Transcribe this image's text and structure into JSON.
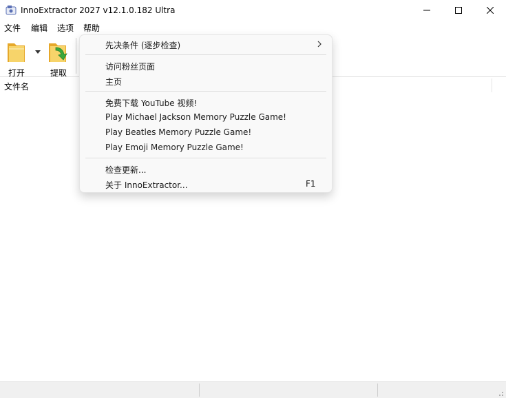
{
  "window": {
    "title": "InnoExtractor 2027 v12.1.0.182 Ultra",
    "controls": [
      "minimize-icon",
      "maximize-icon",
      "close-icon"
    ]
  },
  "menubar": {
    "file": "文件",
    "edit": "编辑",
    "options": "选项",
    "help": "帮助"
  },
  "toolbar": {
    "open_label": "打开",
    "extract_label": "提取"
  },
  "list": {
    "column_filename": "文件名"
  },
  "help_menu": {
    "prerequisites": "先决条件 (逐步检查)",
    "visit_fan_page": "访问粉丝页面",
    "homepage": "主页",
    "youtube": "免费下载 YouTube 视频!",
    "mj_game": "Play Michael Jackson Memory Puzzle Game!",
    "beatles_game": "Play Beatles Memory Puzzle Game!",
    "emoji_game": "Play Emoji Memory Puzzle Game!",
    "check_updates": "检查更新...",
    "about": "关于 InnoExtractor...",
    "about_shortcut": "F1"
  },
  "colors": {
    "folder": "#f2c24a",
    "extract_arrow": "#3aa83a",
    "menu_bg": "#f9f9f9",
    "statusbar_bg": "#f0f0f0"
  }
}
